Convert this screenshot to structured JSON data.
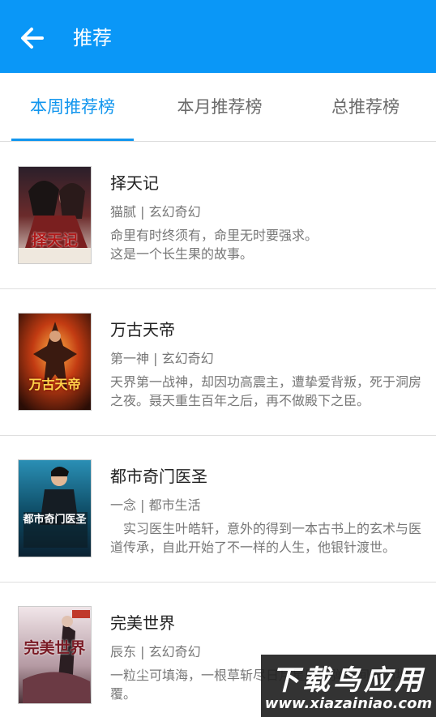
{
  "appbar": {
    "title": "推荐",
    "back_icon": "arrow-left-icon",
    "color": "#0a97f7"
  },
  "tabs": [
    {
      "label": "本周推荐榜",
      "active": true
    },
    {
      "label": "本月推荐榜",
      "active": false
    },
    {
      "label": "总推荐榜",
      "active": false
    }
  ],
  "books": [
    {
      "title": "择天记",
      "meta": "猫腻 | 玄幻奇幻",
      "desc": "命里有时终须有，命里无时要强求。\n这是一个长生果的故事。",
      "cover_text": "择天记"
    },
    {
      "title": "万古天帝",
      "meta": "第一神 | 玄幻奇幻",
      "desc": "天界第一战神，却因功高震主，遭挚爱背叛，死于洞房之夜。聂天重生百年之后，再不做殿下之臣。",
      "cover_text": "万古天帝"
    },
    {
      "title": "都市奇门医圣",
      "meta": "一念 | 都市生活",
      "desc": "　实习医生叶皓轩，意外的得到一本古书上的玄术与医道传承，自此开始了不一样的人生，他银针渡世。",
      "cover_text": "都市奇门医圣"
    },
    {
      "title": "完美世界",
      "meta": "辰东 | 玄幻奇幻",
      "desc": "一粒尘可填海，一根草斩尽日月星辰，弹指间天翻地覆。",
      "cover_text": "完美世界"
    }
  ],
  "watermark": {
    "big": "下载鸟应用",
    "small": "www.xiazainiao.com"
  }
}
